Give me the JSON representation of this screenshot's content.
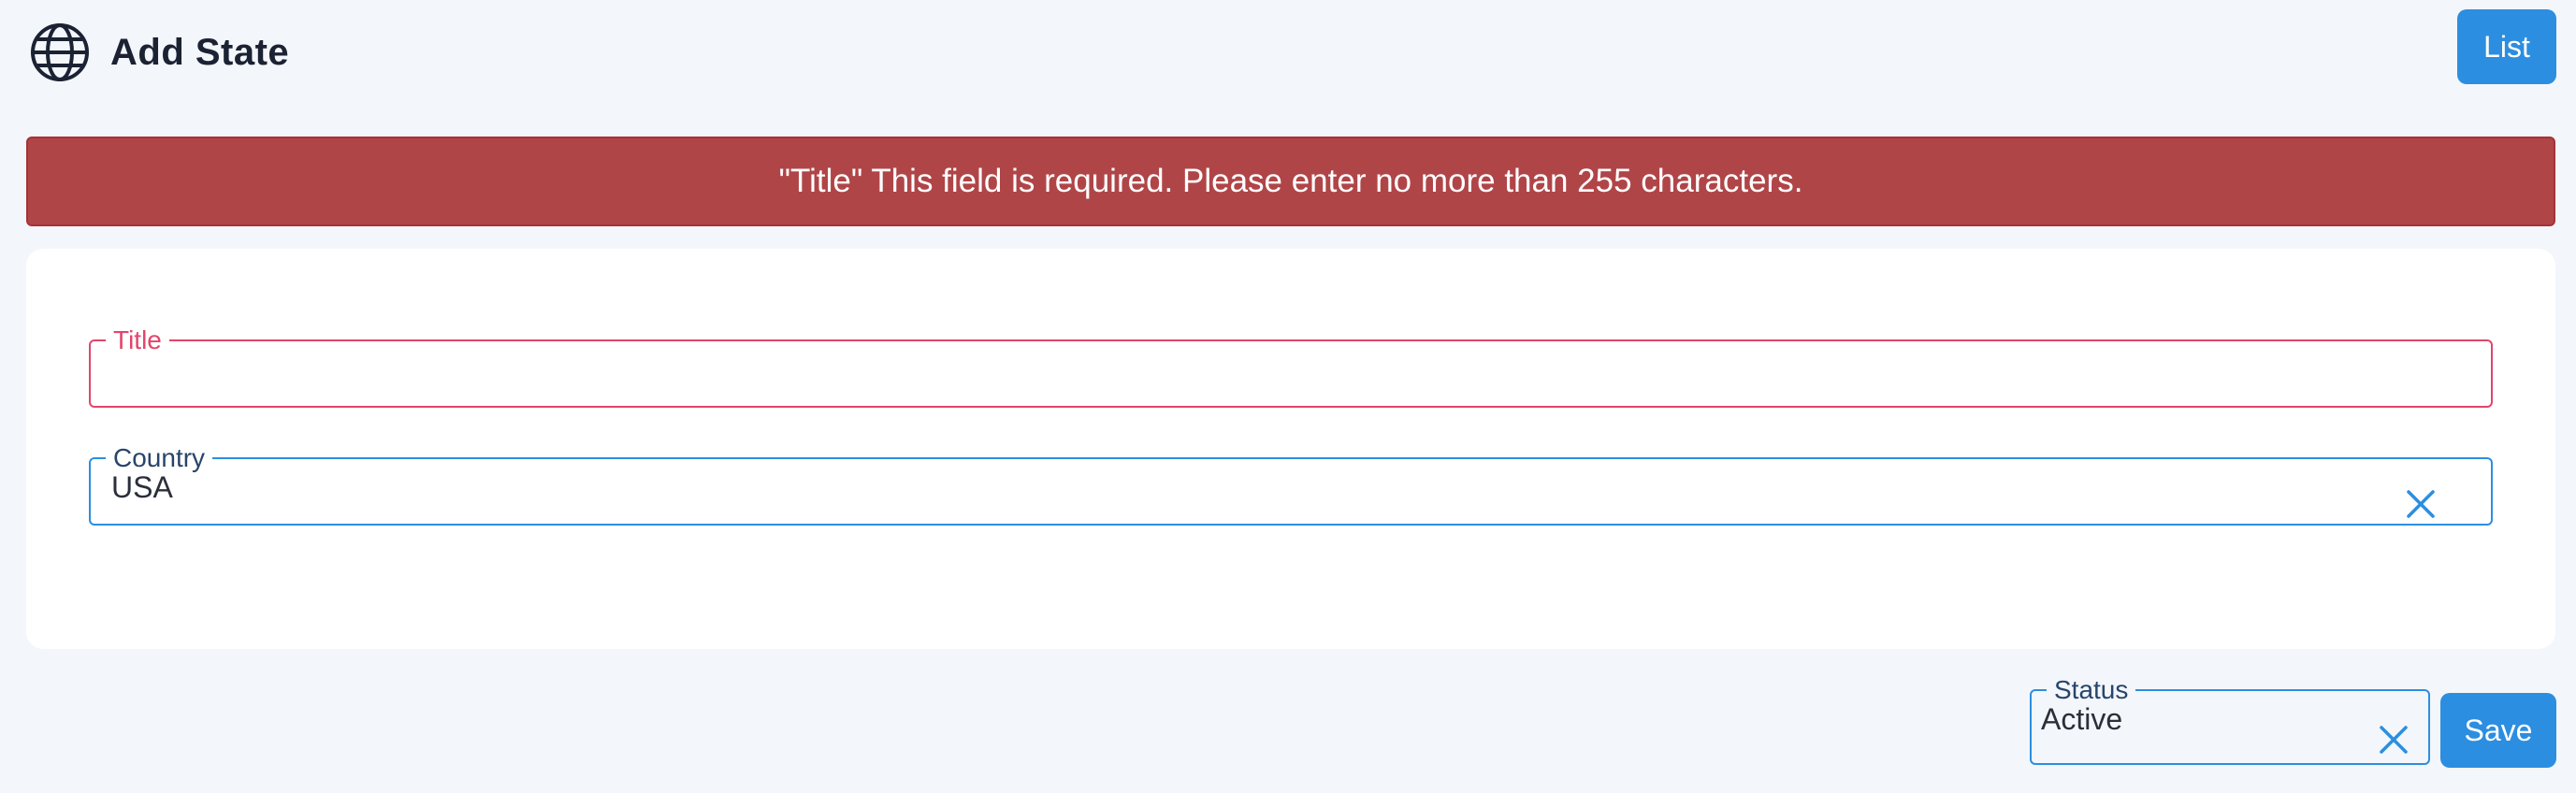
{
  "header": {
    "title": "Add State",
    "icon": "globe-icon",
    "list_label": "List"
  },
  "alert": {
    "message": "\"Title\" This field is required. Please enter no more than 255 characters."
  },
  "form": {
    "title": {
      "label": "Title",
      "value": ""
    },
    "country": {
      "label": "Country",
      "value": "USA",
      "clear_icon": "close-icon"
    },
    "status": {
      "label": "Status",
      "value": "Active",
      "clear_icon": "close-icon"
    },
    "save_label": "Save"
  },
  "colors": {
    "primary": "#2c8ee0",
    "error_bg": "#b04548",
    "error_text": "#e2456b",
    "page_bg": "#f3f6fa"
  }
}
